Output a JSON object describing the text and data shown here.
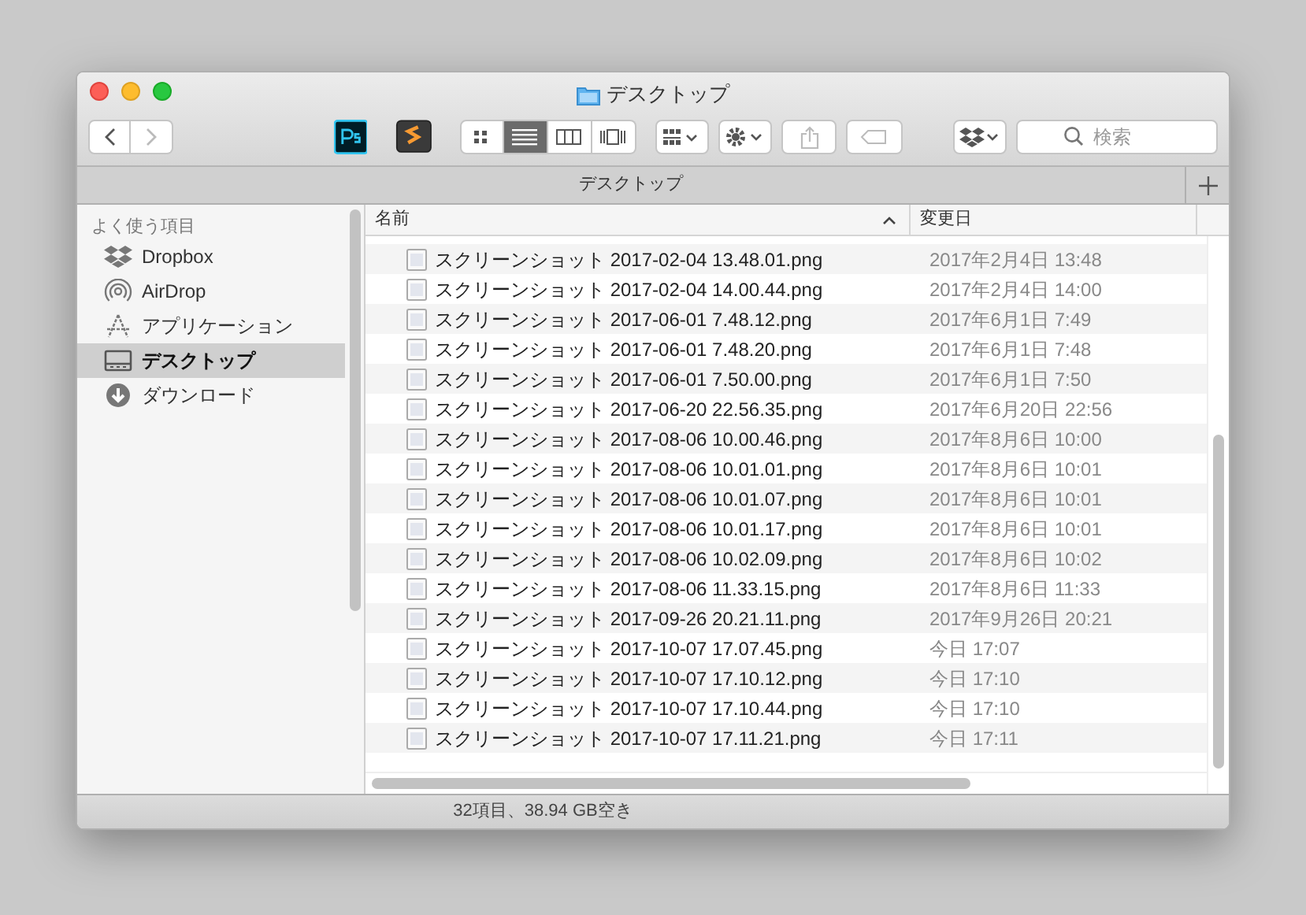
{
  "window": {
    "title": "デスクトップ"
  },
  "toolbar": {
    "view_modes": [
      {
        "kind": "icons",
        "selected": false
      },
      {
        "kind": "list",
        "selected": true
      },
      {
        "kind": "columns",
        "selected": false
      },
      {
        "kind": "coverflow",
        "selected": false
      }
    ],
    "search": {
      "placeholder": "検索"
    }
  },
  "tab_bar": {
    "tabs": [
      {
        "label": "デスクトップ",
        "selected": true
      }
    ]
  },
  "sidebar": {
    "section": "よく使う項目",
    "items": [
      {
        "label": "Dropbox",
        "kind": "dropbox",
        "selected": false
      },
      {
        "label": "AirDrop",
        "kind": "airdrop",
        "selected": false
      },
      {
        "label": "アプリケーション",
        "kind": "apps",
        "selected": false
      },
      {
        "label": "デスクトップ",
        "kind": "desktop",
        "selected": true
      },
      {
        "label": "ダウンロード",
        "kind": "downloads",
        "selected": false
      }
    ]
  },
  "table": {
    "columns": [
      {
        "label": "名前",
        "sorted": true
      },
      {
        "label": "変更日",
        "sorted": false
      }
    ],
    "rows": [
      {
        "name": "スクリーンショット 2017-02-04 13.48.01.png",
        "modified": "2017年2月4日 13:48"
      },
      {
        "name": "スクリーンショット 2017-02-04 14.00.44.png",
        "modified": "2017年2月4日 14:00"
      },
      {
        "name": "スクリーンショット 2017-06-01 7.48.12.png",
        "modified": "2017年6月1日 7:49"
      },
      {
        "name": "スクリーンショット 2017-06-01 7.48.20.png",
        "modified": "2017年6月1日 7:48"
      },
      {
        "name": "スクリーンショット 2017-06-01 7.50.00.png",
        "modified": "2017年6月1日 7:50"
      },
      {
        "name": "スクリーンショット 2017-06-20 22.56.35.png",
        "modified": "2017年6月20日 22:56"
      },
      {
        "name": "スクリーンショット 2017-08-06 10.00.46.png",
        "modified": "2017年8月6日 10:00"
      },
      {
        "name": "スクリーンショット 2017-08-06 10.01.01.png",
        "modified": "2017年8月6日 10:01"
      },
      {
        "name": "スクリーンショット 2017-08-06 10.01.07.png",
        "modified": "2017年8月6日 10:01"
      },
      {
        "name": "スクリーンショット 2017-08-06 10.01.17.png",
        "modified": "2017年8月6日 10:01"
      },
      {
        "name": "スクリーンショット 2017-08-06 10.02.09.png",
        "modified": "2017年8月6日 10:02"
      },
      {
        "name": "スクリーンショット 2017-08-06 11.33.15.png",
        "modified": "2017年8月6日 11:33"
      },
      {
        "name": "スクリーンショット 2017-09-26 20.21.11.png",
        "modified": "2017年9月26日 20:21"
      },
      {
        "name": "スクリーンショット 2017-10-07 17.07.45.png",
        "modified": "今日 17:07"
      },
      {
        "name": "スクリーンショット 2017-10-07 17.10.12.png",
        "modified": "今日 17:10"
      },
      {
        "name": "スクリーンショット 2017-10-07 17.10.44.png",
        "modified": "今日 17:10"
      },
      {
        "name": "スクリーンショット 2017-10-07 17.11.21.png",
        "modified": "今日 17:11"
      }
    ]
  },
  "status_bar": "32項目、38.94 GB空き"
}
